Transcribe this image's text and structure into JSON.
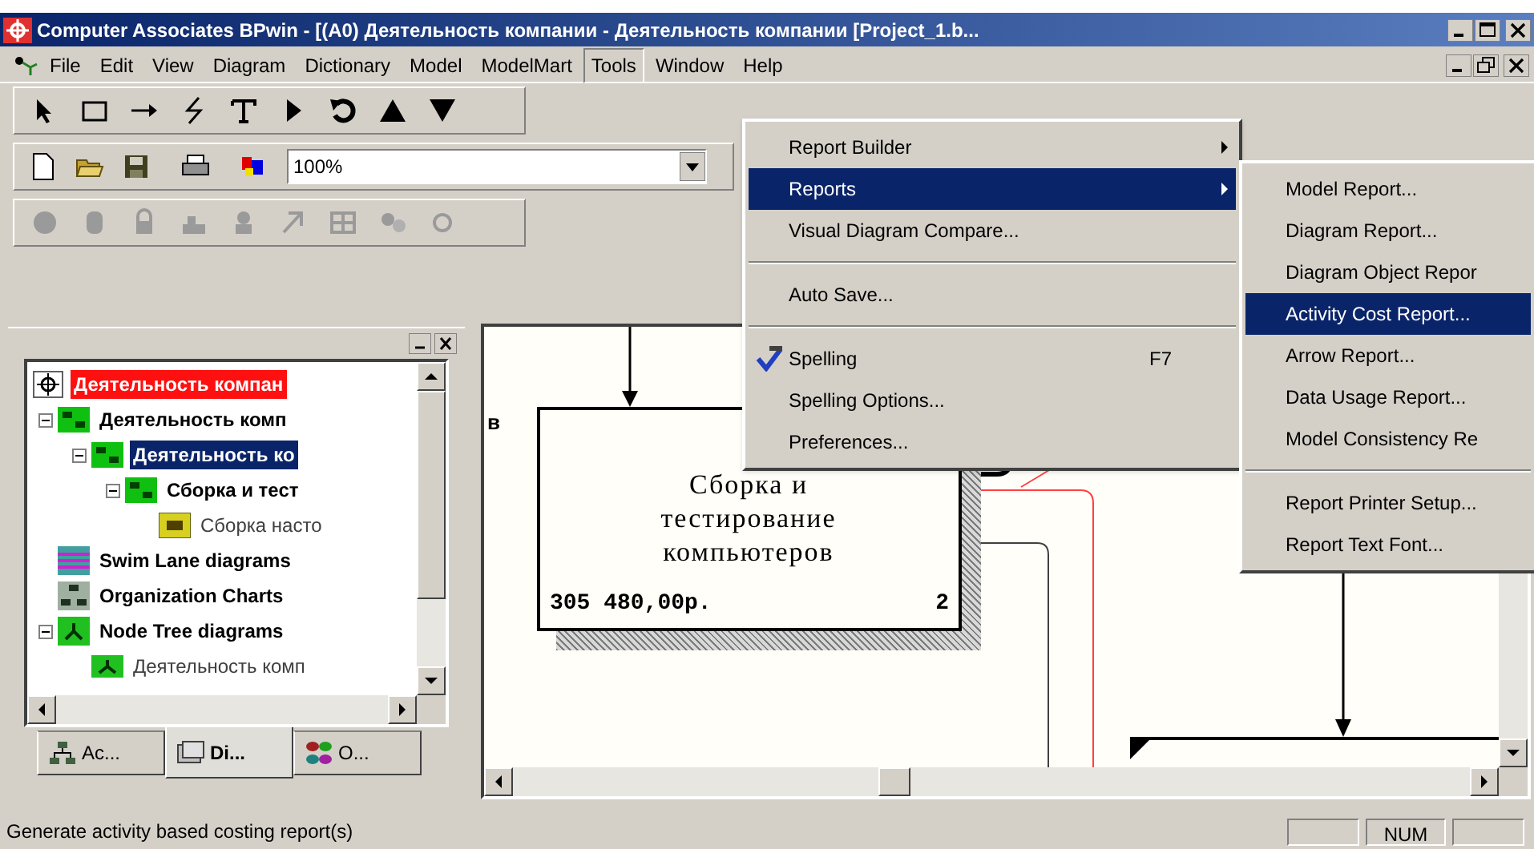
{
  "title_bar": {
    "title": "Computer Associates BPwin - [(A0) Деятельность компании - Деятельность компании  [Project_1.b..."
  },
  "menu_bar": [
    {
      "label": "File",
      "selected": false
    },
    {
      "label": "Edit",
      "selected": false
    },
    {
      "label": "View",
      "selected": false
    },
    {
      "label": "Diagram",
      "selected": false
    },
    {
      "label": "Dictionary",
      "selected": false
    },
    {
      "label": "Model",
      "selected": false
    },
    {
      "label": "ModelMart",
      "selected": false
    },
    {
      "label": "Tools",
      "selected": true
    },
    {
      "label": "Window",
      "selected": false
    },
    {
      "label": "Help",
      "selected": false
    }
  ],
  "zoom_combo": {
    "value": "100%"
  },
  "model_explorer": {
    "tree": [
      {
        "label": "Деятельность компан",
        "kind": "context",
        "highlighted": true,
        "selected": false,
        "children": [
          {
            "label": "Деятельность комп",
            "kind": "decomposition",
            "highlighted": false,
            "selected": false,
            "expanded": true,
            "children": [
              {
                "label": "Деятельность ко",
                "kind": "decomposition",
                "highlighted": false,
                "selected": true,
                "expanded": true,
                "children": [
                  {
                    "label": "Сборка и  тест",
                    "kind": "decomposition",
                    "highlighted": false,
                    "selected": false,
                    "expanded": true,
                    "children": [
                      {
                        "label": "Сборка насто",
                        "kind": "leaf",
                        "highlighted": false,
                        "selected": false
                      }
                    ]
                  }
                ]
              }
            ]
          },
          {
            "label": "Swim Lane diagrams",
            "kind": "swimlane",
            "highlighted": false,
            "selected": false
          },
          {
            "label": "Organization Charts",
            "kind": "orgchart",
            "highlighted": false,
            "selected": false
          },
          {
            "label": "Node Tree diagrams",
            "kind": "nodetree",
            "highlighted": false,
            "selected": false,
            "expanded": true,
            "children": [
              {
                "label": "Деятельность комп",
                "kind": "leafnode",
                "highlighted": false,
                "selected": false
              }
            ]
          }
        ]
      }
    ],
    "tabs": [
      {
        "label": "Ac...",
        "kind": "activities",
        "selected": false
      },
      {
        "label": "Di...",
        "kind": "diagrams",
        "selected": true
      },
      {
        "label": "O...",
        "kind": "objects",
        "selected": false
      }
    ]
  },
  "diagram": {
    "side_label": "в",
    "box": {
      "name": "Сборка и тестирование компьютеров",
      "cost": "305 480,00р.",
      "number": "2"
    }
  },
  "tools_menu": [
    {
      "kind": "item",
      "label": "Report Builder",
      "submenu": true,
      "selected": false
    },
    {
      "kind": "item",
      "label": "Reports",
      "submenu": true,
      "selected": true
    },
    {
      "kind": "item",
      "label": "Visual Diagram Compare...",
      "submenu": false,
      "selected": false
    },
    {
      "kind": "separator"
    },
    {
      "kind": "item",
      "label": "Auto Save...",
      "submenu": false,
      "selected": false
    },
    {
      "kind": "separator"
    },
    {
      "kind": "spelling",
      "label": "Spelling",
      "shortcut": "F7",
      "submenu": false,
      "selected": false
    },
    {
      "kind": "item",
      "label": "Spelling Options...",
      "submenu": false,
      "selected": false
    },
    {
      "kind": "item",
      "label": "Preferences...",
      "submenu": false,
      "selected": false
    }
  ],
  "reports_submenu": [
    {
      "kind": "item",
      "label": "Model Report...",
      "selected": false
    },
    {
      "kind": "item",
      "label": "Diagram Report...",
      "selected": false
    },
    {
      "kind": "item",
      "label": "Diagram Object Repor",
      "selected": false
    },
    {
      "kind": "item",
      "label": "Activity Cost Report...",
      "selected": true
    },
    {
      "kind": "item",
      "label": "Arrow Report...",
      "selected": false
    },
    {
      "kind": "item",
      "label": "Data Usage Report...",
      "selected": false
    },
    {
      "kind": "item",
      "label": "Model Consistency Re",
      "selected": false
    },
    {
      "kind": "separator"
    },
    {
      "kind": "item",
      "label": "Report Printer Setup...",
      "selected": false
    },
    {
      "kind": "item",
      "label": "Report Text Font...",
      "selected": false
    }
  ],
  "status_bar": {
    "message": "Generate activity based costing report(s)",
    "num_indicator": "NUM"
  }
}
